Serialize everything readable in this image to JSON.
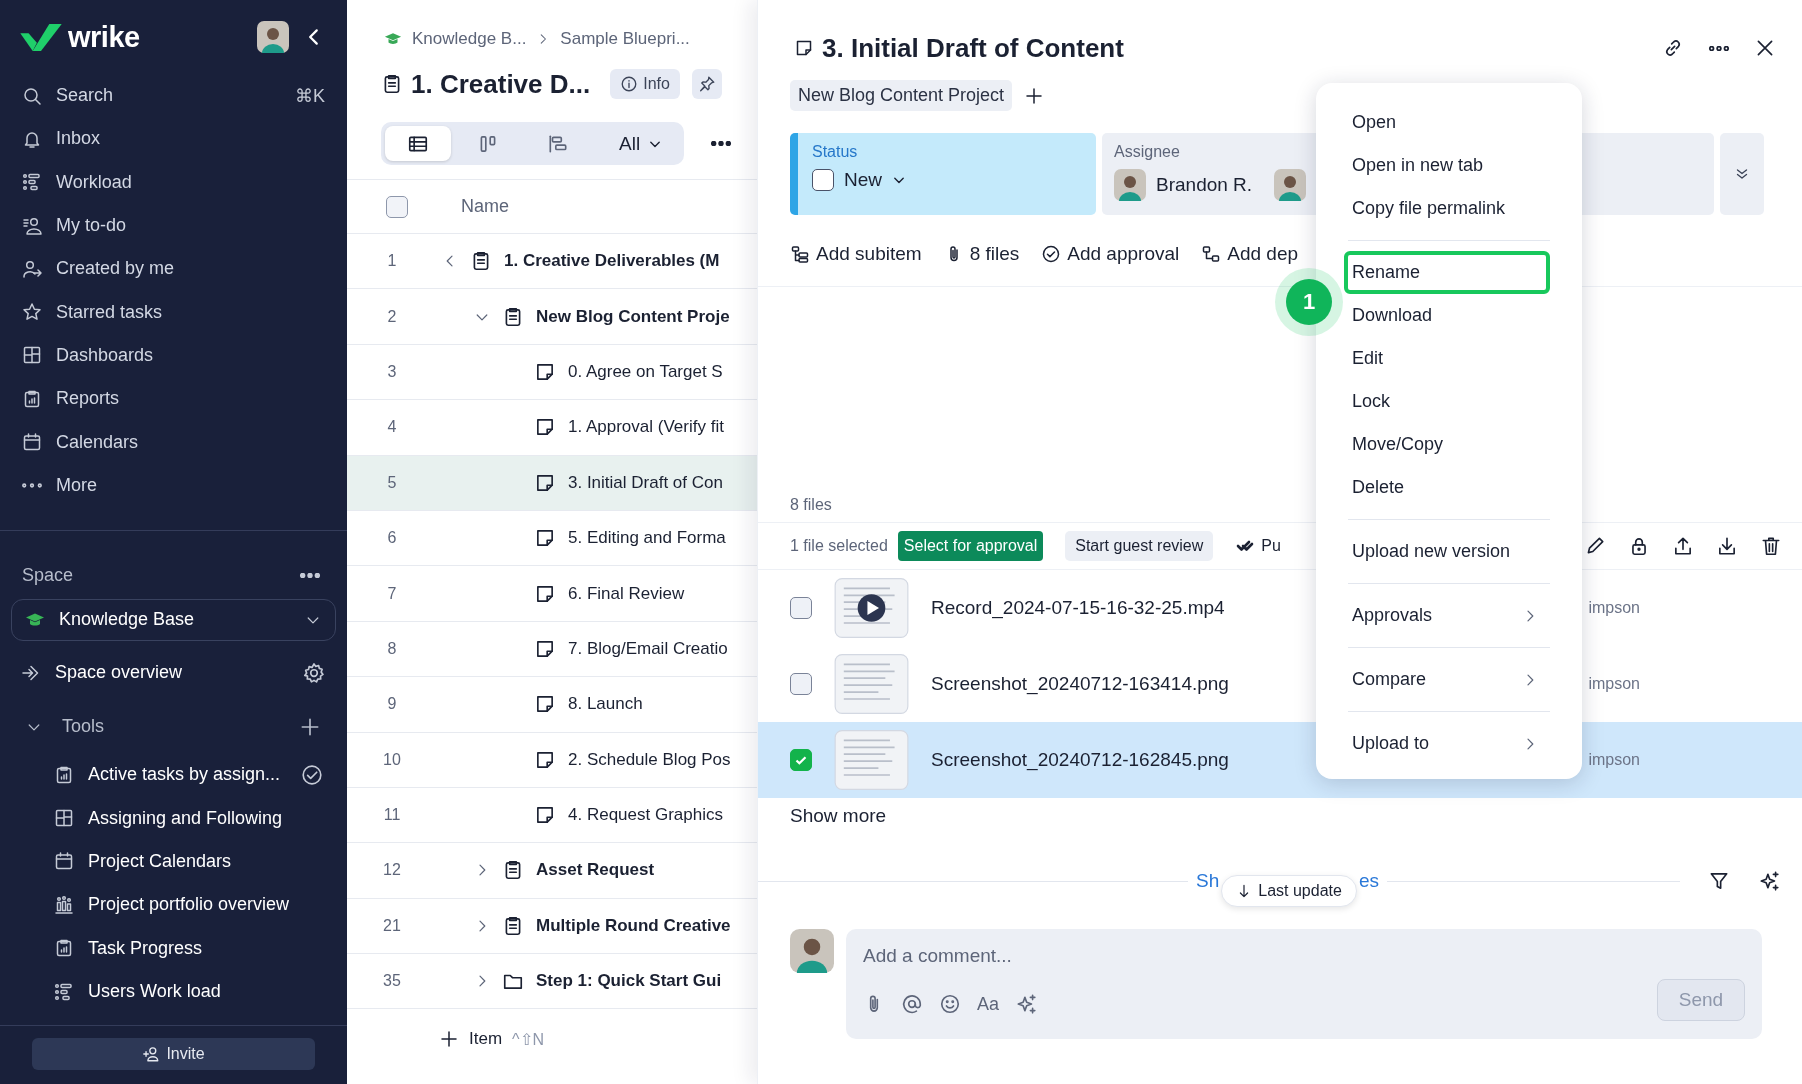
{
  "sidebar": {
    "logo": "wrike",
    "nav": [
      {
        "label": "Search",
        "shortcut": "⌘K",
        "kind": "search"
      },
      {
        "label": "Inbox",
        "kind": "inbox"
      },
      {
        "label": "Workload",
        "kind": "workload"
      },
      {
        "label": "My to-do",
        "kind": "todo"
      },
      {
        "label": "Created by me",
        "kind": "created"
      },
      {
        "label": "Starred tasks",
        "kind": "starred"
      },
      {
        "label": "Dashboards",
        "kind": "dashboard"
      },
      {
        "label": "Reports",
        "kind": "report"
      },
      {
        "label": "Calendars",
        "kind": "calendar"
      },
      {
        "label": "More",
        "kind": "more"
      }
    ],
    "space": {
      "heading": "Space",
      "selector": "Knowledge Base",
      "overview": "Space overview"
    },
    "tools": {
      "heading": "Tools",
      "expanded": true,
      "items": [
        {
          "label": "Active tasks by assign...",
          "kind": "report",
          "verified": true
        },
        {
          "label": "Assigning and Following",
          "kind": "dashboard",
          "verified": false
        },
        {
          "label": "Project Calendars",
          "kind": "calendar",
          "verified": false
        },
        {
          "label": "Project portfolio overview",
          "kind": "portfolio",
          "verified": false
        },
        {
          "label": "Task Progress",
          "kind": "report",
          "verified": false
        },
        {
          "label": "Users Work load",
          "kind": "workload",
          "verified": false
        }
      ]
    },
    "invite": "Invite"
  },
  "list": {
    "breadcrumb": [
      "Knowledge B...",
      "Sample Bluepri..."
    ],
    "title": "1. Creative D...",
    "info": "Info",
    "views": [
      {
        "kind": "table",
        "selected": true
      },
      {
        "kind": "board",
        "selected": false
      },
      {
        "kind": "gantt",
        "selected": false
      }
    ],
    "filter": "All",
    "column": "Name",
    "select_all_checked": false,
    "rows": [
      {
        "number": "1",
        "name": "1. Creative Deliverables (M",
        "kind": "project",
        "expanded": true,
        "selected": false,
        "children": [
          {
            "number": "2",
            "name": "New Blog Content Proje",
            "kind": "project",
            "expanded": true,
            "selected": false,
            "children": [
              {
                "number": "3",
                "name": "0. Agree on Target S",
                "kind": "task",
                "selected": false
              },
              {
                "number": "4",
                "name": "1. Approval (Verify fit",
                "kind": "task",
                "selected": false
              },
              {
                "number": "5",
                "name": "3. Initial Draft of Con",
                "kind": "task",
                "selected": true
              },
              {
                "number": "6",
                "name": "5. Editing and Forma",
                "kind": "task",
                "selected": false
              },
              {
                "number": "7",
                "name": "6. Final Review",
                "kind": "task",
                "selected": false
              },
              {
                "number": "8",
                "name": "7. Blog/Email Creatio",
                "kind": "task",
                "selected": false
              },
              {
                "number": "9",
                "name": "8. Launch",
                "kind": "task",
                "selected": false
              },
              {
                "number": "10",
                "name": "2. Schedule Blog Pos",
                "kind": "task",
                "selected": false
              },
              {
                "number": "11",
                "name": "4. Request Graphics",
                "kind": "task",
                "selected": false
              }
            ]
          },
          {
            "number": "12",
            "name": "Asset Request",
            "kind": "project",
            "expanded": false,
            "selected": false
          },
          {
            "number": "21",
            "name": "Multiple Round Creative",
            "kind": "project",
            "expanded": false,
            "selected": false
          },
          {
            "number": "35",
            "name": "Step 1: Quick Start Gui",
            "kind": "folder",
            "expanded": false,
            "selected": false
          }
        ]
      }
    ],
    "add_item": {
      "label": "Item",
      "shortcut": "^⇧N"
    }
  },
  "detail": {
    "title": "3. Initial Draft of Content",
    "parent": "New Blog Content Project",
    "status": {
      "label": "Status",
      "value": "New",
      "checked": false
    },
    "assignee": {
      "label": "Assignee",
      "name": "Brandon R."
    },
    "actions": [
      {
        "label": "Add subitem",
        "kind": "subitem"
      },
      {
        "label": "8 files",
        "kind": "attach"
      },
      {
        "label": "Add approval",
        "kind": "approval"
      },
      {
        "label": "Add dep",
        "kind": "dependency"
      }
    ],
    "files": {
      "count": "8 files",
      "selection": "1 file selected",
      "approve": "Select for approval",
      "review": "Start guest review",
      "proof": "Pu",
      "rows": [
        {
          "name": "Record_2024-07-15-16-32-25.mp4",
          "owner": "impson",
          "kind": "video",
          "checked": false
        },
        {
          "name": "Screenshot_20240712-163414.png",
          "owner": "impson",
          "kind": "image",
          "checked": false
        },
        {
          "name": "Screenshot_20240712-162845.png",
          "owner": "impson",
          "kind": "image",
          "checked": true
        }
      ],
      "more": "Show more"
    },
    "updates": {
      "left": "Sh",
      "right": "es",
      "chip": "Last update"
    },
    "comment": {
      "placeholder": "Add a comment...",
      "format": "Aa",
      "send": "Send"
    }
  },
  "menu": {
    "groups": [
      [
        {
          "label": "Open",
          "submenu": false,
          "highlighted": false
        },
        {
          "label": "Open in new tab",
          "submenu": false,
          "highlighted": false
        },
        {
          "label": "Copy file permalink",
          "submenu": false,
          "highlighted": false
        }
      ],
      [
        {
          "label": "Rename",
          "submenu": false,
          "highlighted": true
        },
        {
          "label": "Download",
          "submenu": false,
          "highlighted": false
        },
        {
          "label": "Edit",
          "submenu": false,
          "highlighted": false
        },
        {
          "label": "Lock",
          "submenu": false,
          "highlighted": false
        },
        {
          "label": "Move/Copy",
          "submenu": false,
          "highlighted": false
        },
        {
          "label": "Delete",
          "submenu": false,
          "highlighted": false
        }
      ],
      [
        {
          "label": "Upload new version",
          "submenu": false,
          "highlighted": false
        }
      ],
      [
        {
          "label": "Approvals",
          "submenu": true,
          "highlighted": false
        }
      ],
      [
        {
          "label": "Compare",
          "submenu": true,
          "highlighted": false
        }
      ],
      [
        {
          "label": "Upload to",
          "submenu": true,
          "highlighted": false
        }
      ]
    ]
  },
  "step": "1"
}
